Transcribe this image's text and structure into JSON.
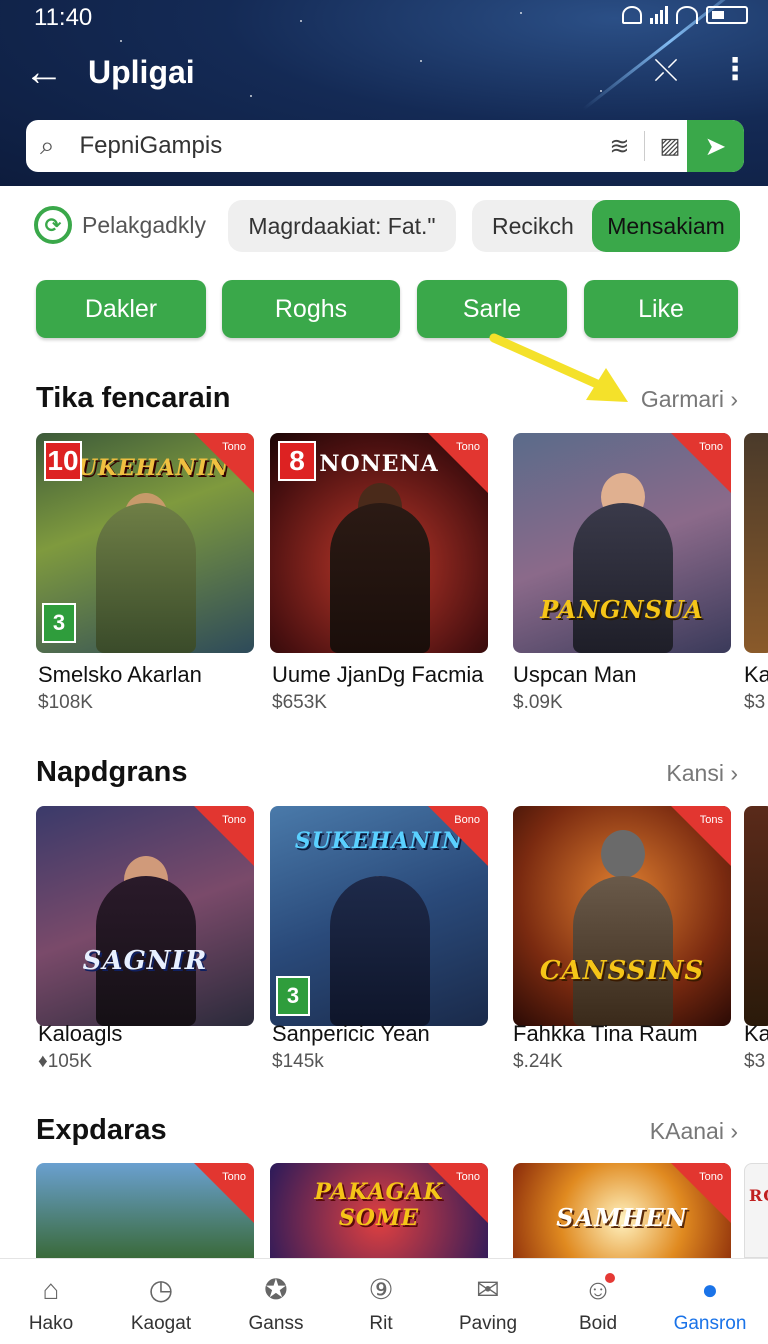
{
  "status": {
    "time": "11:40"
  },
  "appbar": {
    "title": "Upligai",
    "back_icon": "arrow-left-icon",
    "share_icon": "share-icon",
    "more_icon": "more-vert-icon"
  },
  "search": {
    "value": "FepniGampis",
    "placeholder": "FepniGampis"
  },
  "filters": {
    "brand_label": "Pelakgadkly",
    "chip1": "Magrdaakiat:  Fat.\"",
    "chip2": "Recikch",
    "chip3": "Mensakiam"
  },
  "categories": [
    "Dakler",
    "Roghs",
    "Sarle",
    "Like"
  ],
  "sections": [
    {
      "title": "Tika fencarain",
      "more": "Garmari",
      "items": [
        {
          "name": "Smelsko Akarlan",
          "price": "$108K",
          "logo": "SUKEHANIN",
          "rating": "3",
          "num": "10",
          "badge": "Tono"
        },
        {
          "name": "Uume JjanDg Facmia",
          "price": "$653K",
          "logo": "NONENA",
          "num": "8",
          "badge": "Tono"
        },
        {
          "name": "Uspcan Man",
          "price": "$.09K",
          "logo": "PANGNSUA",
          "badge": "Tono"
        },
        {
          "name": "Ka",
          "price": "$3"
        }
      ]
    },
    {
      "title": "Napdgrans",
      "more": "Kansi",
      "items": [
        {
          "name": "Kaloagls",
          "price": "♦105K",
          "logo": "SAGNIR",
          "badge": "Tono"
        },
        {
          "name": "Sanpericic Yean",
          "price": "$145k",
          "logo": "SUKEHANIN",
          "rating": "3",
          "badge": "Bono"
        },
        {
          "name": "Fahkka Tina Raum",
          "price": "$.24K",
          "logo": "CANSSINS",
          "badge": "Tons"
        },
        {
          "name": "Ka",
          "price": "$3"
        }
      ]
    },
    {
      "title": "Expdaras",
      "more": "KAanai",
      "items": [
        {
          "logo": "",
          "badge": "Tono"
        },
        {
          "logo": "PAKAGAK SOME",
          "badge": "Tono"
        },
        {
          "logo": "SAMHEN",
          "badge": "Tono"
        },
        {
          "logo": "RO"
        }
      ]
    }
  ],
  "bottom_nav": [
    {
      "label": "Hako",
      "icon": "home-icon"
    },
    {
      "label": "Kaogat",
      "icon": "compass-icon"
    },
    {
      "label": "Ganss",
      "icon": "gamepad-icon"
    },
    {
      "label": "Rit",
      "icon": "badge-icon"
    },
    {
      "label": "Paving",
      "icon": "mail-icon"
    },
    {
      "label": "Boid",
      "icon": "user-notify-icon"
    },
    {
      "label": "Gansron",
      "icon": "profile-icon"
    }
  ],
  "colors": {
    "accent_green": "#3aa84a",
    "header_bg": "#142a55",
    "active_blue": "#1a73e8",
    "corner_red": "#e23630"
  }
}
